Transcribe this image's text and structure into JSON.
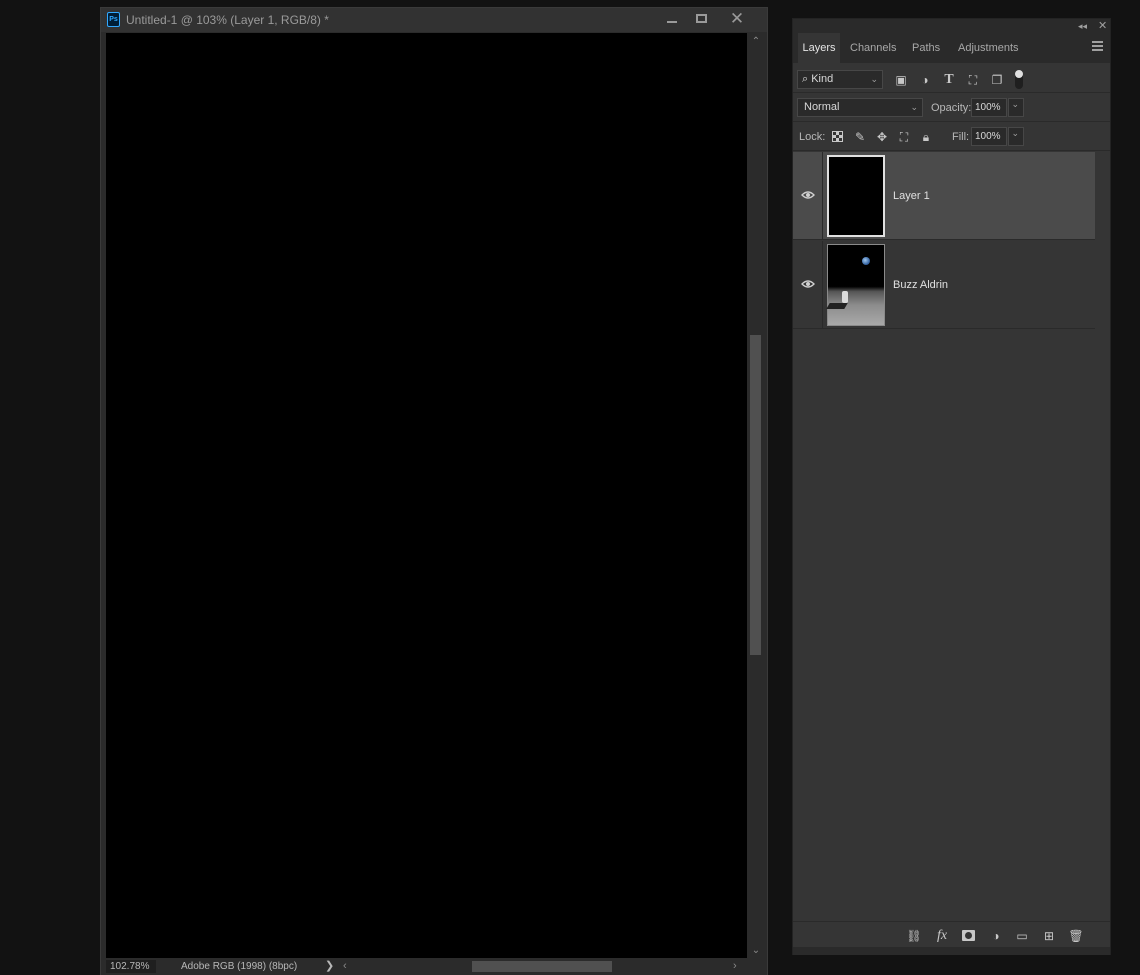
{
  "document": {
    "app_icon": "ps-icon",
    "app_badge": "Ps",
    "title": "Untitled-1 @ 103% (Layer 1, RGB/8) *",
    "window_controls": {
      "minimize": "minimize-icon",
      "maximize": "maximize-icon",
      "close": "✕"
    },
    "canvas_color": "#000000",
    "status": {
      "zoom": "102.78%",
      "profile": "Adobe RGB (1998) (8bpc)",
      "menu_arrow": "❯",
      "scroll_left": "‹",
      "scroll_right": "›"
    },
    "scroll": {
      "up": "⌃",
      "down": "⌄"
    }
  },
  "layers_panel": {
    "collapse": "◂◂",
    "close": "✕",
    "tabs": [
      {
        "label": "Layers",
        "active": true
      },
      {
        "label": "Channels",
        "active": false
      },
      {
        "label": "Paths",
        "active": false
      },
      {
        "label": "Adjustments",
        "active": false
      }
    ],
    "filter": {
      "kind_label": "⌕ Kind",
      "chevron": "⌄",
      "icons": [
        "pixel-filter-icon",
        "adjustment-filter-icon",
        "type-filter-icon",
        "shape-filter-icon",
        "smart-object-filter-icon"
      ],
      "type_glyph": "T"
    },
    "blend": {
      "mode": "Normal",
      "opacity_label": "Opacity:",
      "opacity": "100%",
      "chevron": "⌄"
    },
    "lock": {
      "label": "Lock:",
      "fill_label": "Fill:",
      "fill": "100%",
      "chevron": "⌄"
    },
    "layers": [
      {
        "name": "Layer 1",
        "visible": true,
        "selected": true,
        "thumbnail": "black-fill"
      },
      {
        "name": "Buzz Aldrin",
        "visible": true,
        "selected": false,
        "thumbnail": "moon-photo"
      }
    ],
    "bottom_icons": [
      "link-layers-icon",
      "fx-icon",
      "add-mask-icon",
      "adjustment-layer-icon",
      "new-group-icon",
      "new-layer-icon",
      "delete-layer-icon"
    ],
    "fx_label": "fx",
    "colors": {
      "selected_row": "#4b4b4b",
      "panel_bg": "#353535",
      "accent_ps": "#31a8ff"
    }
  }
}
